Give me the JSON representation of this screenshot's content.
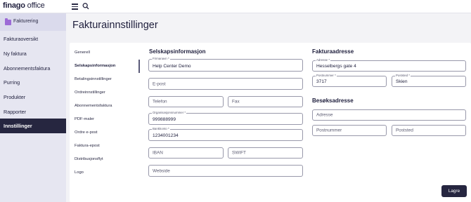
{
  "app": {
    "brand": "finago",
    "product": " office"
  },
  "sidebar": {
    "module": "Fakturering",
    "items": [
      {
        "label": "Fakturaoversikt"
      },
      {
        "label": "Ny faktura"
      },
      {
        "label": "Abonnementsfaktura"
      },
      {
        "label": "Purring"
      },
      {
        "label": "Produkter"
      },
      {
        "label": "Rapporter"
      },
      {
        "label": "Innstillinger",
        "active": true
      }
    ]
  },
  "page": {
    "title": "Fakturainnstillinger"
  },
  "settings_nav": [
    {
      "label": "Generell"
    },
    {
      "label": "Selskapsinformasjon",
      "active": true
    },
    {
      "label": "Betalingsinnstillinger"
    },
    {
      "label": "Ordreinnstillinger"
    },
    {
      "label": "Abonnementsfaktura"
    },
    {
      "label": "PDF-maler"
    },
    {
      "label": "Ordre e-post"
    },
    {
      "label": "Faktura-epost"
    },
    {
      "label": "Distribusjonsflyt"
    },
    {
      "label": "Logo"
    }
  ],
  "company": {
    "heading": "Selskapsinformasjon",
    "name": {
      "label": "Firmanavn *",
      "value": "Help Center Demo"
    },
    "email": {
      "placeholder": "E-post"
    },
    "phone": {
      "placeholder": "Telefon"
    },
    "fax": {
      "placeholder": "Fax"
    },
    "org_number": {
      "label": "Organisasjonsnummer *",
      "value": "999888999"
    },
    "bank_account": {
      "label": "Bankkonto *",
      "value": "1234001234"
    },
    "iban": {
      "placeholder": "IBAN"
    },
    "swift": {
      "placeholder": "SWIFT"
    },
    "website": {
      "placeholder": "Webside"
    }
  },
  "invoice_address": {
    "heading": "Fakturaadresse",
    "address": {
      "label": "Adresse *",
      "value": "Hesselbergs gate 4"
    },
    "postal_code": {
      "label": "Postnummer *",
      "value": "3717"
    },
    "city": {
      "label": "Poststed *",
      "value": "Skien"
    }
  },
  "visit_address": {
    "heading": "Besøksadresse",
    "address": {
      "placeholder": "Adresse"
    },
    "postal_code": {
      "placeholder": "Postnummer"
    },
    "city": {
      "placeholder": "Poststed"
    }
  },
  "actions": {
    "save": "Lagre"
  },
  "colors": {
    "primary": "#262640",
    "accent": "#9c6ad6",
    "sidebar_bg": "#e6e6f1"
  }
}
